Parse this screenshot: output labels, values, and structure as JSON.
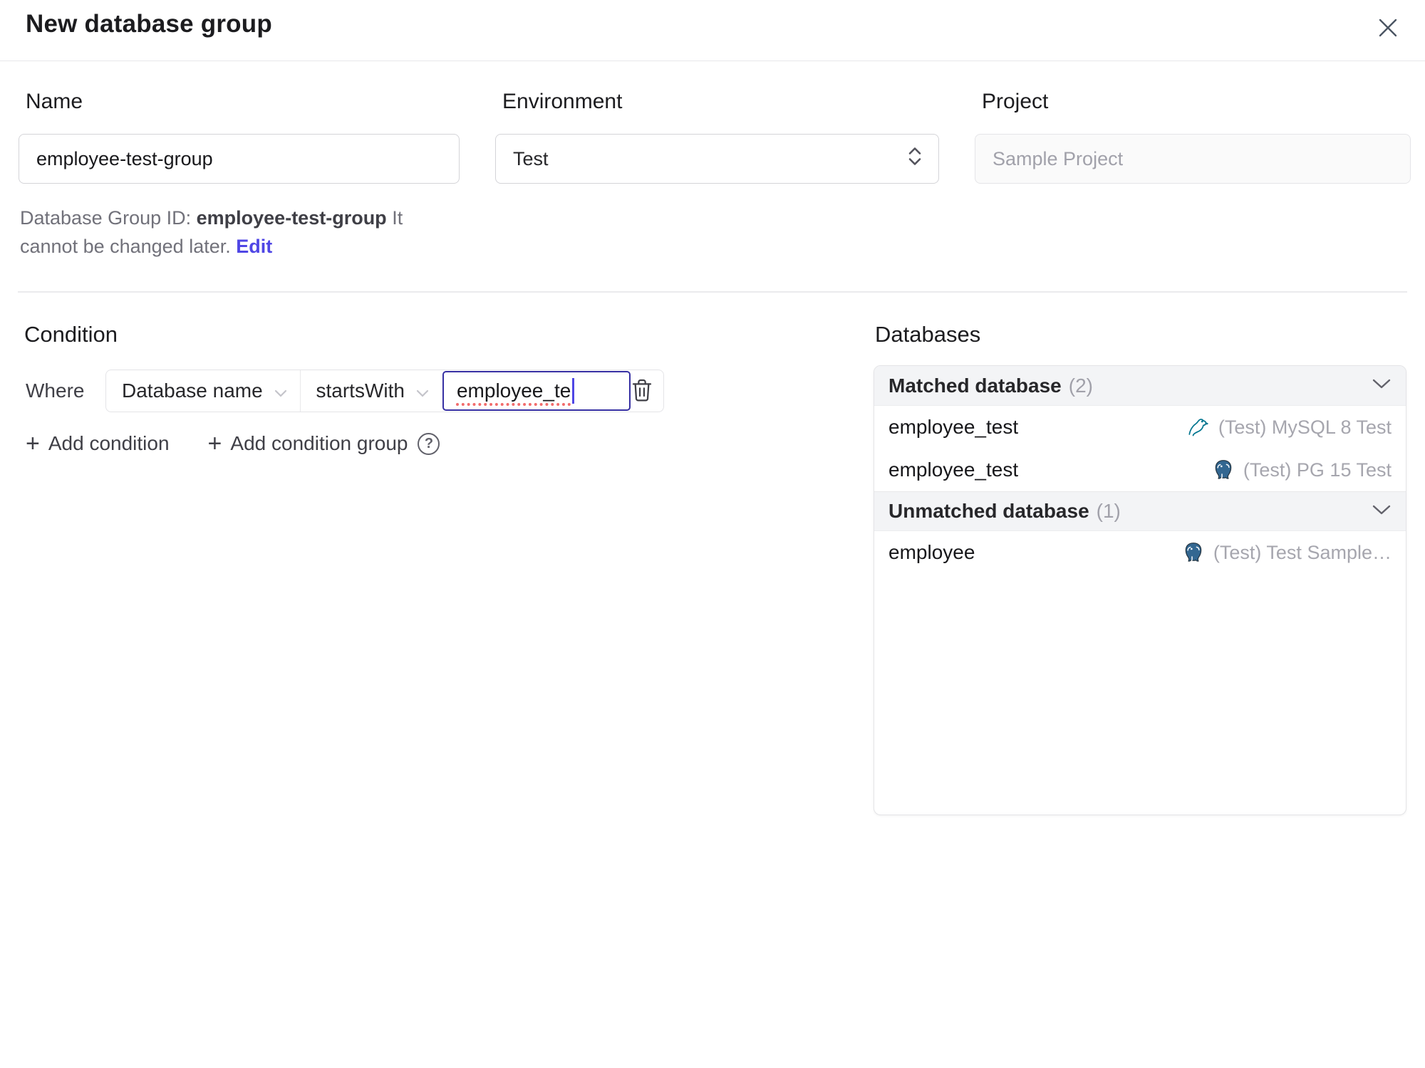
{
  "dialog": {
    "title": "New database group"
  },
  "icons": {
    "close": "close-icon",
    "plus": "+",
    "help": "?"
  },
  "form": {
    "name": {
      "label": "Name",
      "value": "employee-test-group",
      "helper_prefix": "Database Group ID: ",
      "helper_id": "employee-test-group",
      "helper_suffix": " It cannot be changed later. ",
      "edit_link": "Edit"
    },
    "environment": {
      "label": "Environment",
      "value": "Test"
    },
    "project": {
      "label": "Project",
      "value": "Sample Project"
    }
  },
  "condition": {
    "heading": "Condition",
    "where_label": "Where",
    "factor": "Database name",
    "operator": "startsWith",
    "value": "employee_te",
    "add_condition_label": "Add condition",
    "add_condition_group_label": "Add condition group"
  },
  "databases": {
    "heading": "Databases",
    "sections": [
      {
        "title": "Matched database",
        "count": "(2)",
        "rows": [
          {
            "name": "employee_test",
            "engine": "mysql",
            "instance": "(Test) MySQL 8 Test"
          },
          {
            "name": "employee_test",
            "engine": "postgres",
            "instance": "(Test) PG 15 Test"
          }
        ]
      },
      {
        "title": "Unmatched database",
        "count": "(1)",
        "rows": [
          {
            "name": "employee",
            "engine": "postgres",
            "instance": "(Test) Test Sample…"
          }
        ]
      }
    ]
  },
  "colors": {
    "accent": "#4f46e5",
    "focus_border": "#3730a3",
    "mysql_icon": "#00758f",
    "postgres_icon": "#336791",
    "section_header_bg": "#f3f4f6",
    "muted_text": "#a1a1aa"
  }
}
